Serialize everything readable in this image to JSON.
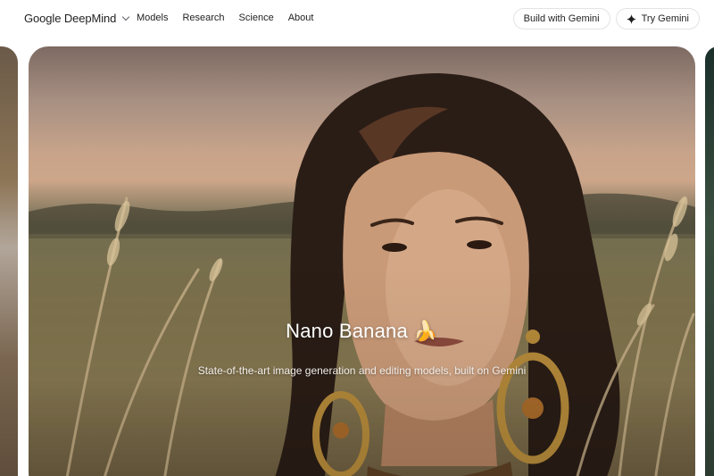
{
  "header": {
    "brand": "Google DeepMind",
    "nav": [
      "Models",
      "Research",
      "Science",
      "About"
    ],
    "build_label": "Build with Gemini",
    "try_label": "Try Gemini"
  },
  "hero": {
    "title": "Nano Banana 🍌",
    "subtitle": "State-of-the-art image generation and editing models, built on Gemini"
  }
}
